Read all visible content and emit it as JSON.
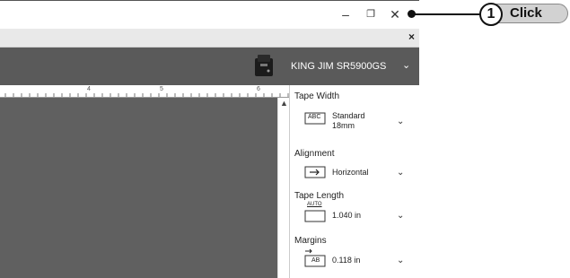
{
  "window": {
    "minimize_glyph": "–",
    "restore_glyph": "❐",
    "close_glyph": "✕"
  },
  "banner": {
    "close_glyph": "×"
  },
  "printer": {
    "name": "KING JIM SR5900GS",
    "dropdown_glyph": "⌄"
  },
  "ruler": {
    "marks": [
      "4",
      "5",
      "6"
    ]
  },
  "panel": {
    "tape_width": {
      "label": "Tape Width",
      "value_line1": "Standard",
      "value_line2": "18mm",
      "icon_text": "ABC"
    },
    "alignment": {
      "label": "Alignment",
      "value": "Horizontal"
    },
    "tape_length": {
      "label": "Tape Length",
      "value": "1.040 in",
      "icon_text": "AUTO"
    },
    "margins": {
      "label": "Margins",
      "value": "0.118 in",
      "icon_text": "AB"
    }
  },
  "callout": {
    "step": "1",
    "label": "Click"
  },
  "colors": {
    "dark_bar": "#5a5a5a",
    "canvas": "#606060",
    "pill": "#d2d2d2"
  }
}
